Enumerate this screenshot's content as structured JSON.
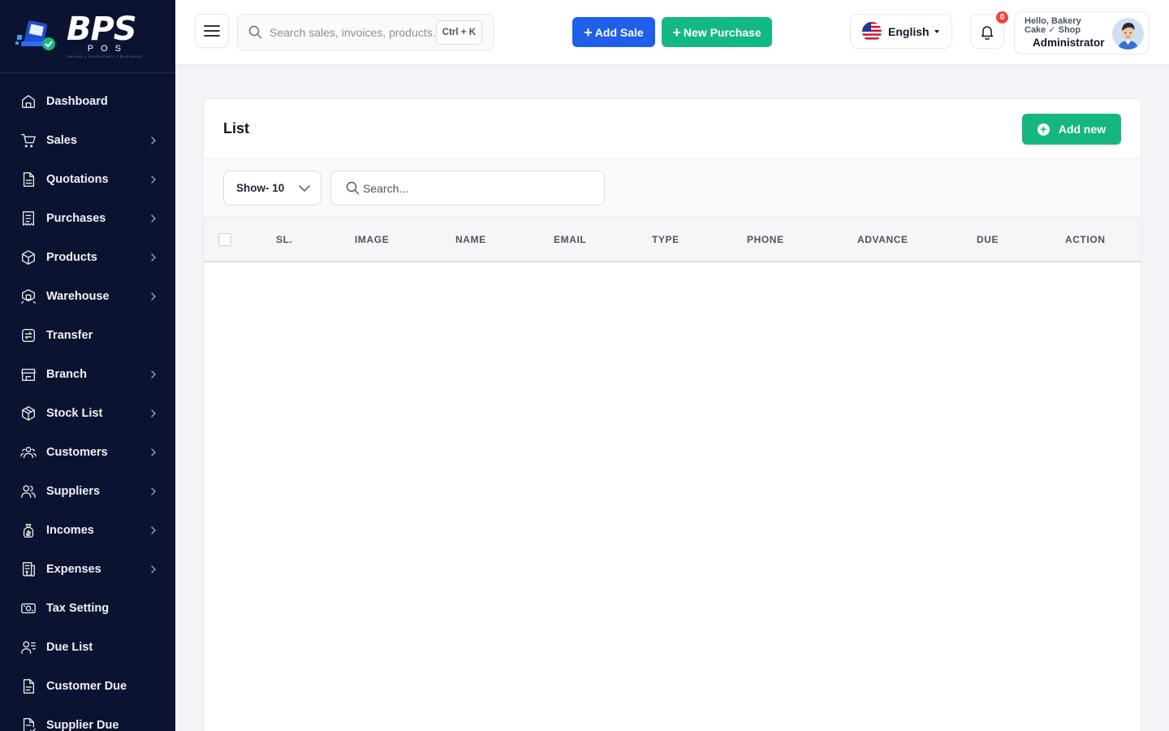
{
  "brand": {
    "name": "BPS",
    "sub": "POS",
    "tagline": "ONLINE | INVENTORY | BUSINESS"
  },
  "sidebar": {
    "items": [
      {
        "label": "Dashboard",
        "icon": "home-icon",
        "has_children": false
      },
      {
        "label": "Sales",
        "icon": "cart-icon",
        "has_children": true
      },
      {
        "label": "Quotations",
        "icon": "file-icon",
        "has_children": true
      },
      {
        "label": "Purchases",
        "icon": "receipt-icon",
        "has_children": true
      },
      {
        "label": "Products",
        "icon": "box-icon",
        "has_children": true
      },
      {
        "label": "Warehouse",
        "icon": "warehouse-icon",
        "has_children": true
      },
      {
        "label": "Transfer",
        "icon": "transfer-icon",
        "has_children": false
      },
      {
        "label": "Branch",
        "icon": "store-icon",
        "has_children": true
      },
      {
        "label": "Stock List",
        "icon": "cube-icon",
        "has_children": true
      },
      {
        "label": "Customers",
        "icon": "users-icon",
        "has_children": true
      },
      {
        "label": "Suppliers",
        "icon": "user-group-icon",
        "has_children": true
      },
      {
        "label": "Incomes",
        "icon": "money-bag-icon",
        "has_children": true
      },
      {
        "label": "Expenses",
        "icon": "invoice-icon",
        "has_children": true
      },
      {
        "label": "Tax Setting",
        "icon": "tax-icon",
        "has_children": false
      },
      {
        "label": "Due List",
        "icon": "user-list-icon",
        "has_children": false
      },
      {
        "label": "Customer Due",
        "icon": "document-icon",
        "has_children": false
      },
      {
        "label": "Supplier Due",
        "icon": "document-check-icon",
        "has_children": false
      }
    ]
  },
  "topbar": {
    "search_placeholder": "Search sales, invoices, products...",
    "shortcut": "Ctrl + K",
    "add_sale": "Add Sale",
    "new_purchase": "New Purchase",
    "language": "English",
    "notification_count": "0",
    "greeting": "Hello, Bakery Cake ✓ Shop",
    "role": "Administrator"
  },
  "page": {
    "title": "List",
    "add_new": "Add new",
    "show_label": "Show- 10",
    "search_placeholder": "Search...",
    "columns": [
      "SL.",
      "IMAGE",
      "NAME",
      "EMAIL",
      "TYPE",
      "PHONE",
      "ADVANCE",
      "DUE",
      "ACTION"
    ],
    "rows": []
  },
  "colors": {
    "sidebar_bg": "#0b1330",
    "primary_blue": "#1f5fea",
    "primary_green": "#12b886",
    "badge_red": "#ef4444"
  }
}
